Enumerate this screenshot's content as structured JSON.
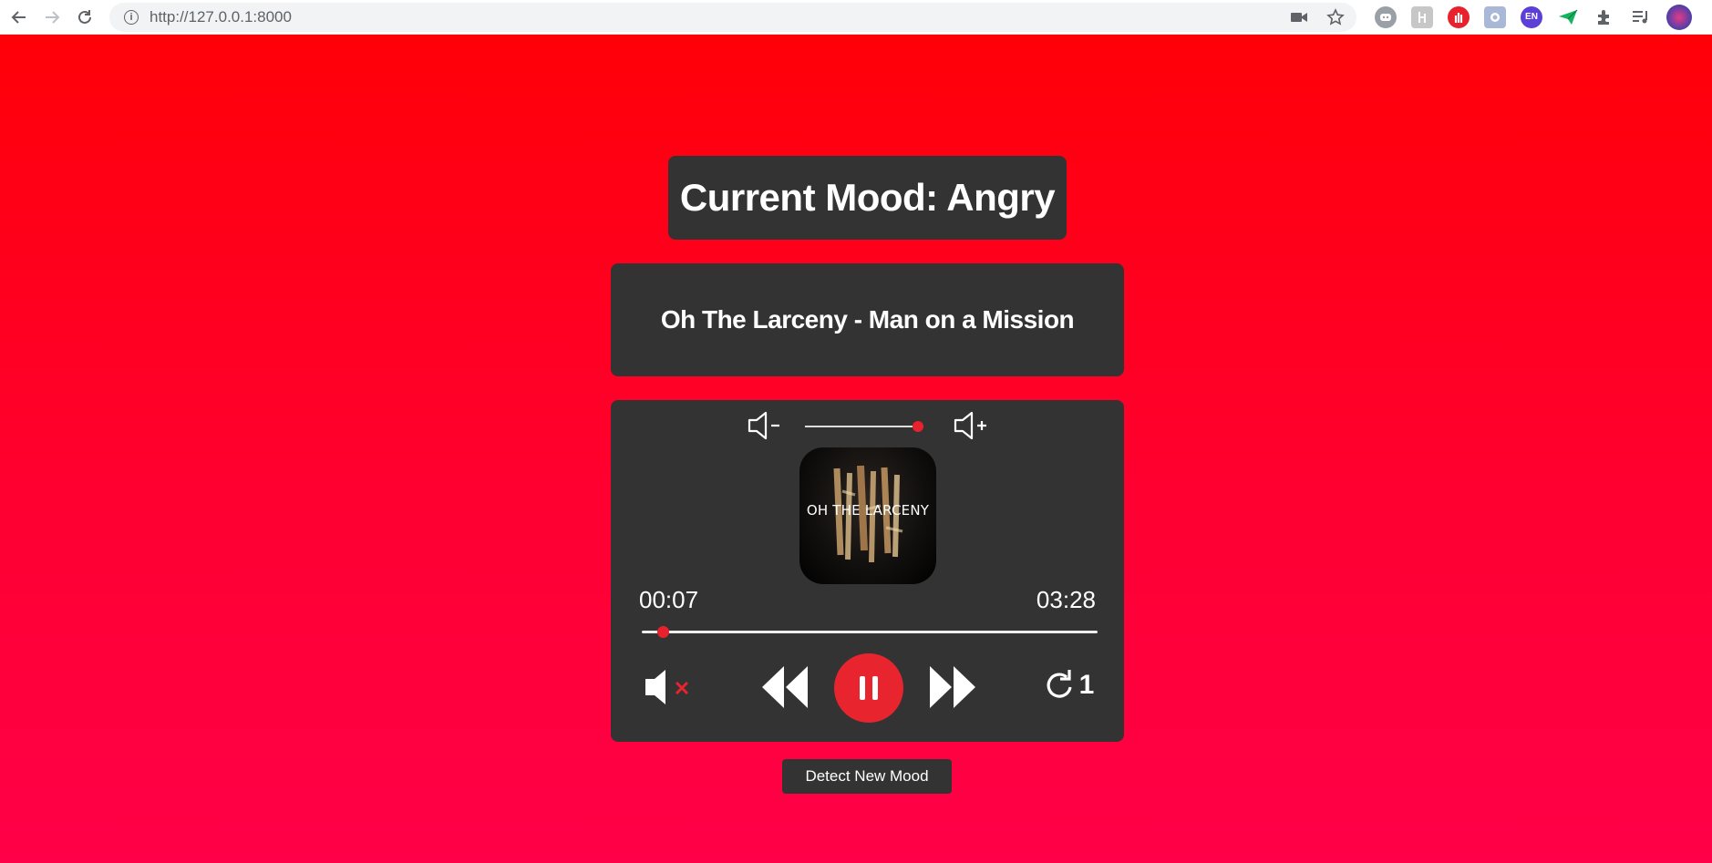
{
  "browser": {
    "url": "http://127.0.0.1:8000",
    "extensions": [
      "discord-icon",
      "puzzle-ext-icon",
      "stop-hand-icon",
      "circle-ext-icon",
      "en-ext-icon",
      "paper-plane-icon",
      "extensions-puzzle-icon",
      "media-queue-icon",
      "profile-avatar"
    ],
    "en_badge_text": "EN"
  },
  "mood": {
    "label": "Current Mood: Angry"
  },
  "track": {
    "title": "Oh The Larceny - Man on a Mission",
    "cover_text": "OH THE LARCENY"
  },
  "player": {
    "current_time": "00:07",
    "duration": "03:28",
    "progress_fraction": 0.034,
    "volume_fraction": 0.95,
    "repeat_count": "1",
    "accent_color": "#e8252f",
    "panel_color": "#333333"
  },
  "actions": {
    "detect_label": "Detect New Mood"
  }
}
